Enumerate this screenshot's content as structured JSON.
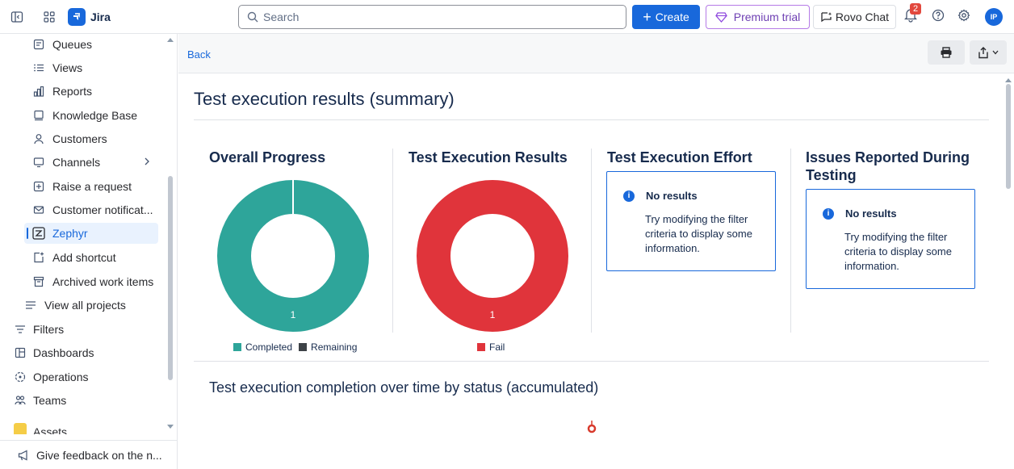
{
  "topbar": {
    "app_name": "Jira",
    "search_placeholder": "Search",
    "create_label": "Create",
    "premium_label": "Premium trial",
    "rovo_label": "Rovo Chat",
    "notification_count": "2",
    "avatar_initials": "IP"
  },
  "sidebar": {
    "items": [
      {
        "label": "Queues",
        "icon": "queues-icon"
      },
      {
        "label": "Views",
        "icon": "views-icon"
      },
      {
        "label": "Reports",
        "icon": "reports-icon"
      },
      {
        "label": "Knowledge Base",
        "icon": "knowledge-base-icon"
      },
      {
        "label": "Customers",
        "icon": "customers-icon"
      },
      {
        "label": "Channels",
        "icon": "channels-icon"
      },
      {
        "label": "Raise a request",
        "icon": "raise-request-icon"
      },
      {
        "label": "Customer notificat...",
        "icon": "mail-icon"
      },
      {
        "label": "Zephyr",
        "icon": "zephyr-icon"
      },
      {
        "label": "Add shortcut",
        "icon": "add-shortcut-icon"
      },
      {
        "label": "Archived work items",
        "icon": "archive-icon"
      },
      {
        "label": "View all projects",
        "icon": "list-icon"
      },
      {
        "label": "Filters",
        "icon": "filter-icon"
      },
      {
        "label": "Dashboards",
        "icon": "dashboard-icon"
      },
      {
        "label": "Operations",
        "icon": "operations-icon"
      },
      {
        "label": "Teams",
        "icon": "teams-icon"
      },
      {
        "label": "Assets",
        "icon": "assets-icon"
      }
    ],
    "feedback_label": "Give feedback on the n..."
  },
  "main": {
    "back_label": "Back",
    "page_title": "Test execution results (summary)",
    "panels": {
      "overall_progress": {
        "title": "Overall Progress",
        "center_value": "1",
        "legend": [
          "Completed",
          "Remaining"
        ]
      },
      "execution_results": {
        "title": "Test Execution Results",
        "center_value": "1",
        "legend": [
          "Fail"
        ]
      },
      "execution_effort": {
        "title": "Test Execution Effort",
        "no_results_title": "No results",
        "no_results_msg": "Try modifying the filter criteria to display some information."
      },
      "issues_reported": {
        "title": "Issues Reported During Testing",
        "no_results_title": "No results",
        "no_results_msg": "Try modifying the filter criteria to display some information."
      }
    },
    "completion_title": "Test execution completion over time by status (accumulated)"
  },
  "colors": {
    "completed": "#2ea59a",
    "remaining": "#3d4247",
    "fail": "#e0343b",
    "brand": "#1868db"
  },
  "chart_data": [
    {
      "type": "pie",
      "categories": [
        "Completed",
        "Remaining"
      ],
      "values": [
        1,
        0
      ]
    },
    {
      "type": "pie",
      "categories": [
        "Fail"
      ],
      "values": [
        1
      ]
    }
  ]
}
